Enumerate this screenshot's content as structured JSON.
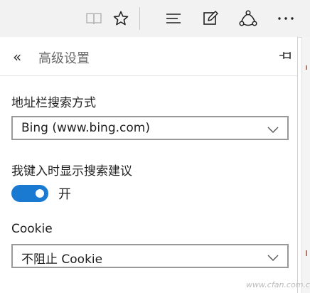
{
  "toolbar": {
    "icons": [
      "reading-view-icon",
      "favorite-star-icon",
      "hub-icon",
      "web-note-icon",
      "share-icon",
      "more-icon"
    ]
  },
  "panel": {
    "title": "高级设置",
    "back_glyph": "«",
    "search_engine": {
      "label": "地址栏搜索方式",
      "value": "Bing (www.bing.com)"
    },
    "suggestions": {
      "label": "我键入时显示搜索建议",
      "state_label": "开",
      "enabled": true
    },
    "cookie": {
      "label": "Cookie",
      "value": "不阻止 Cookie"
    }
  },
  "watermark": "www.cfan.com.cn",
  "colors": {
    "accent": "#1a7ad1",
    "toolbar_bg": "#f2f2f2"
  }
}
